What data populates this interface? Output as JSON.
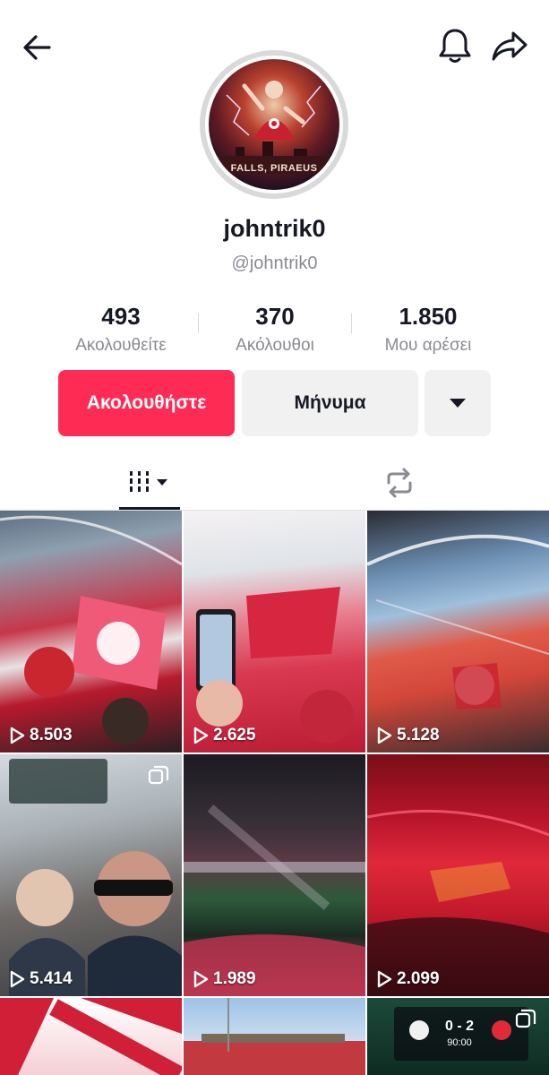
{
  "header": {
    "back_icon": "arrow-left-icon",
    "bell_icon": "bell-icon",
    "share_icon": "share-arrow-icon"
  },
  "profile": {
    "avatar_text": "... FALLS, PIRAEUS ...",
    "display_name": "johntrik0",
    "handle": "@johntrik0"
  },
  "stats": [
    {
      "value": "493",
      "label": "Ακολουθείτε"
    },
    {
      "value": "370",
      "label": "Ακόλουθοι"
    },
    {
      "value": "1.850",
      "label": "Μου αρέσει"
    }
  ],
  "actions": {
    "follow_label": "Ακολουθήστε",
    "message_label": "Μήνυμα",
    "more_icon": "caret-down-icon"
  },
  "tabs": [
    {
      "name": "videos",
      "icon": "grid-bars-icon",
      "selected": true
    },
    {
      "name": "reposts",
      "icon": "repost-icon",
      "selected": false
    }
  ],
  "videos": [
    {
      "views": "8.503"
    },
    {
      "views": "2.625"
    },
    {
      "views": "5.128"
    },
    {
      "views": "5.414"
    },
    {
      "views": "1.989"
    },
    {
      "views": "2.099"
    },
    {
      "views": ""
    },
    {
      "views": ""
    },
    {
      "views": ""
    }
  ],
  "thumb8_text": {
    "score": "0 - 2",
    "time": "90:00"
  },
  "colors": {
    "accent": "#fe2c55",
    "secondary_button": "#f1f1f2",
    "muted_text": "#8a8b91"
  }
}
